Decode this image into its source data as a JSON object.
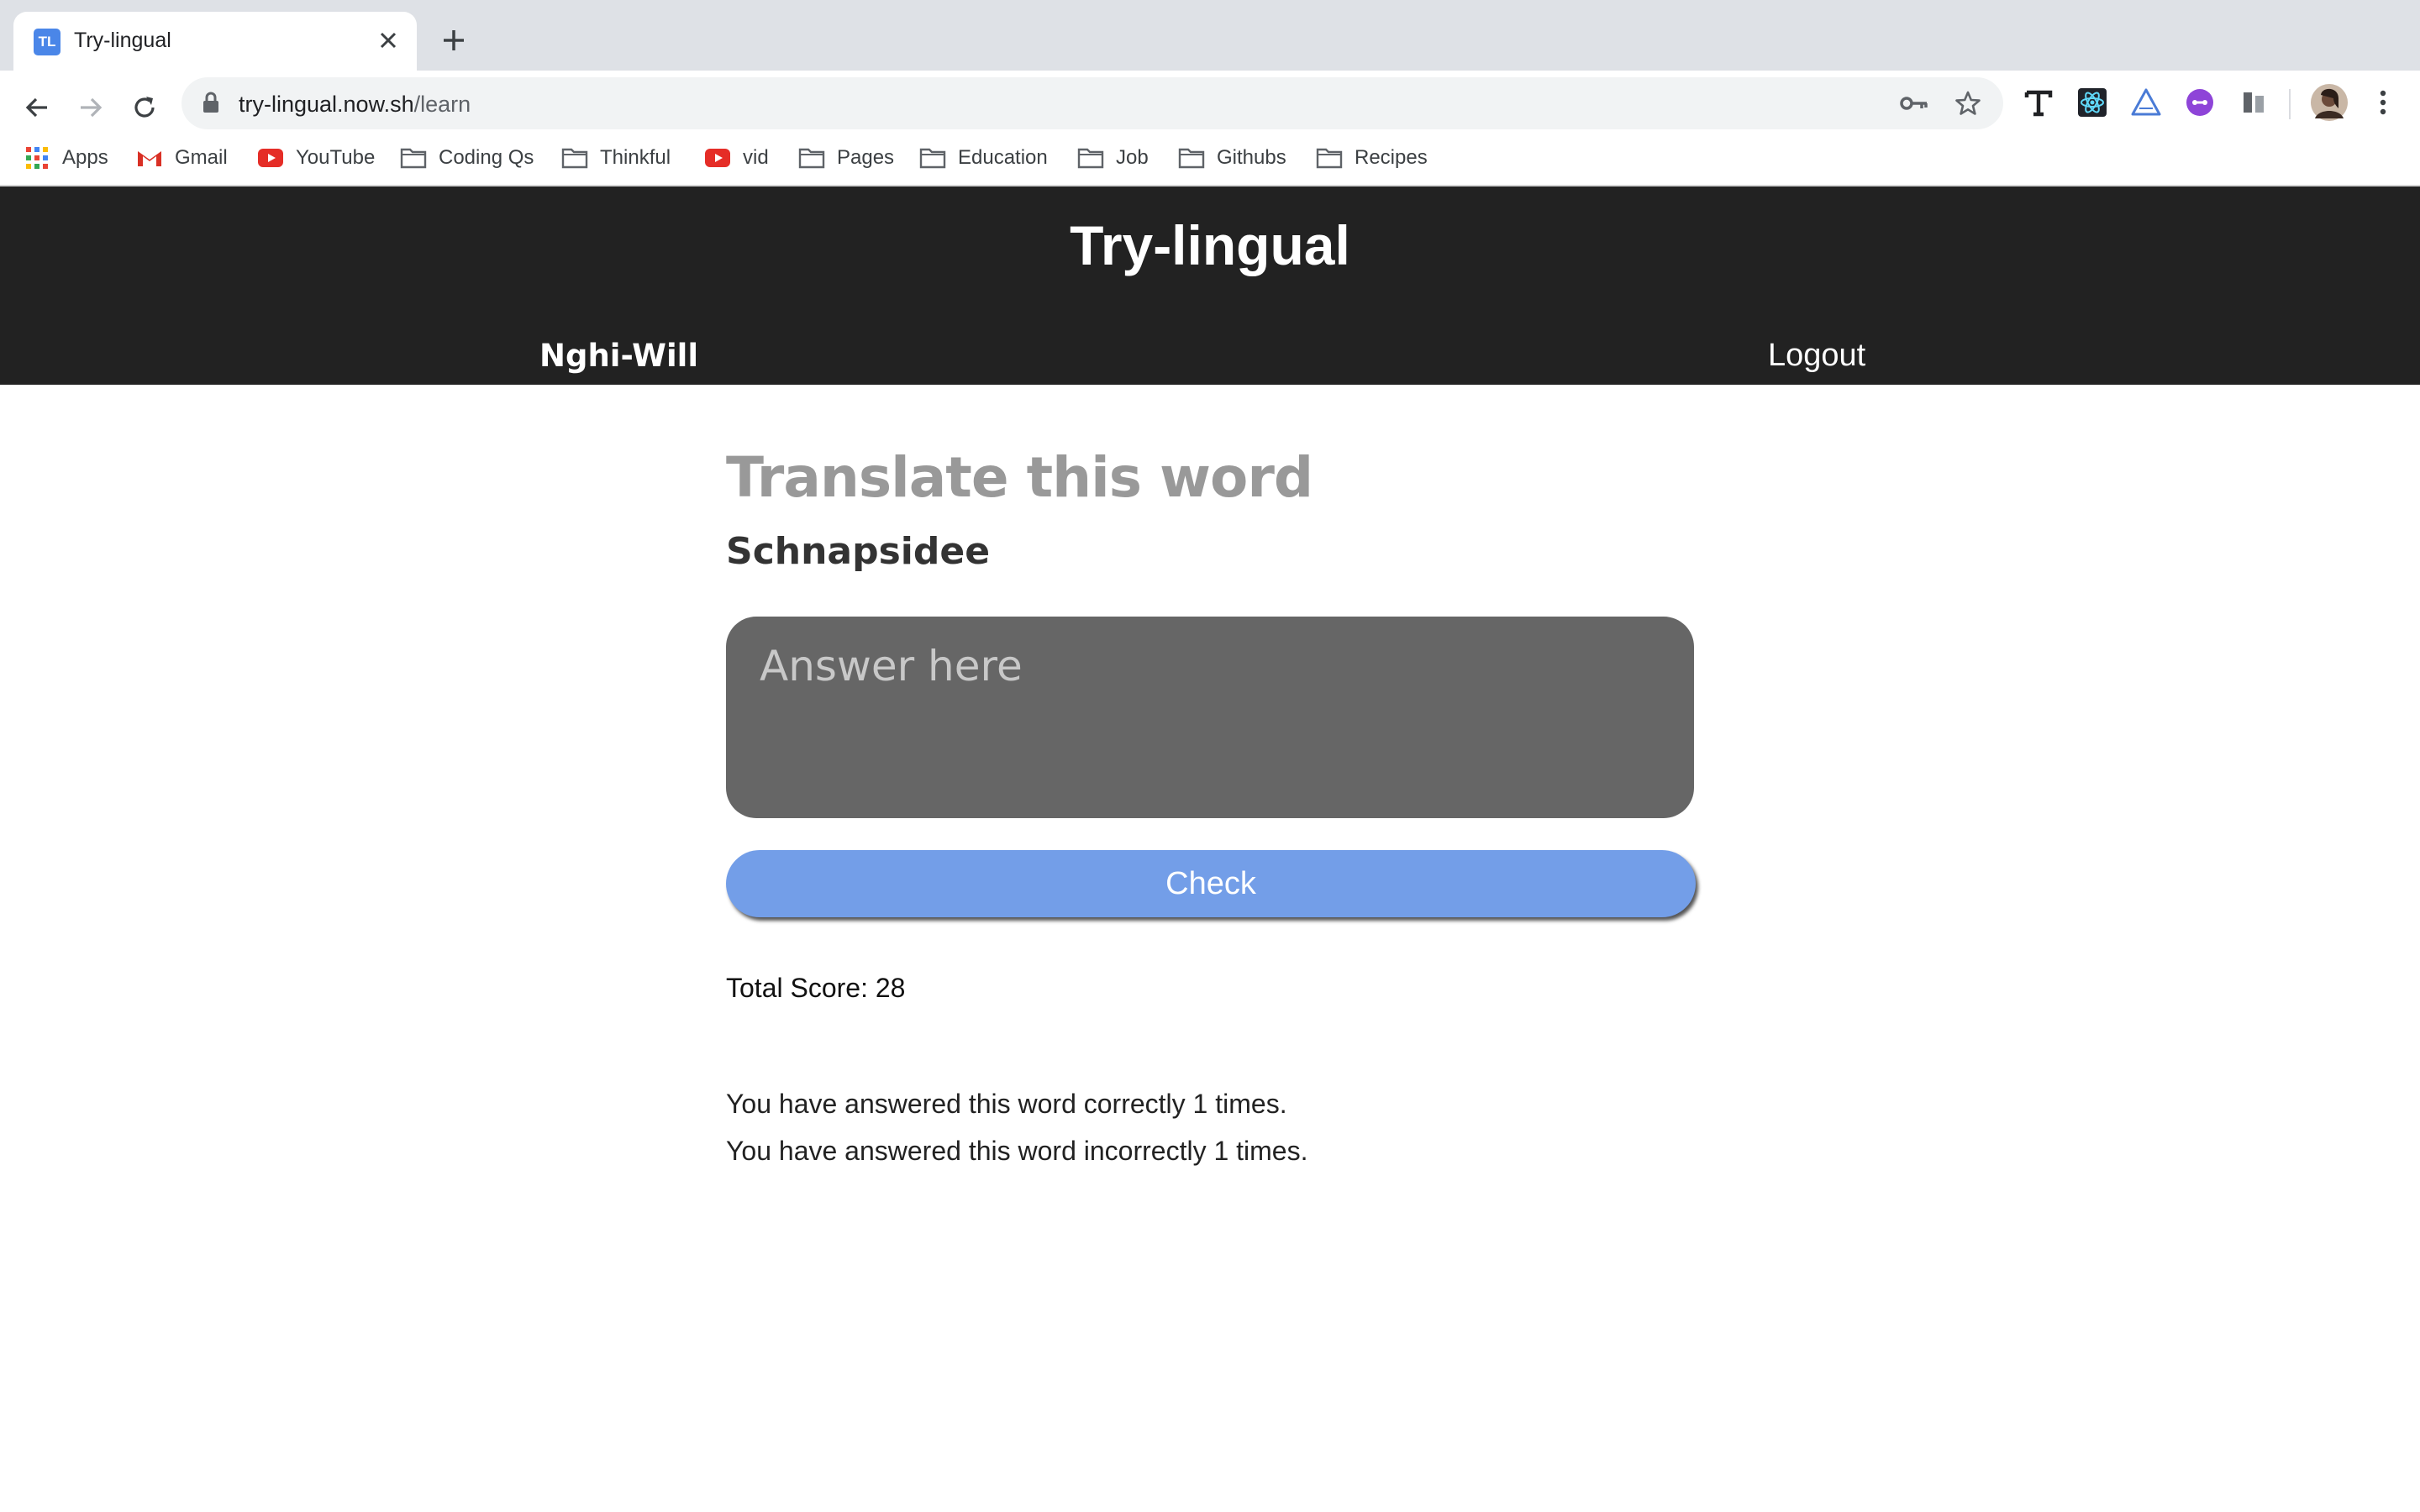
{
  "browser": {
    "tab_title": "Try-lingual",
    "tab_favicon_text": "TL",
    "url_host": "try-lingual.now.sh",
    "url_path": "/learn",
    "bookmarks": [
      {
        "label": "Apps",
        "icon": "apps-grid-icon"
      },
      {
        "label": "Gmail",
        "icon": "gmail-icon"
      },
      {
        "label": "YouTube",
        "icon": "youtube-icon"
      },
      {
        "label": "Coding Qs",
        "icon": "folder-icon"
      },
      {
        "label": "Thinkful",
        "icon": "folder-icon"
      },
      {
        "label": "vid",
        "icon": "youtube-icon"
      },
      {
        "label": "Pages",
        "icon": "folder-icon"
      },
      {
        "label": "Education",
        "icon": "folder-icon"
      },
      {
        "label": "Job",
        "icon": "folder-icon"
      },
      {
        "label": "Githubs",
        "icon": "folder-icon"
      },
      {
        "label": "Recipes",
        "icon": "folder-icon"
      }
    ]
  },
  "header": {
    "title": "Try-lingual",
    "user": "Nghi-Will",
    "logout": "Logout"
  },
  "learn": {
    "heading": "Translate this word",
    "word": "Schnapsidee",
    "answer_placeholder": "Answer here",
    "check_label": "Check",
    "total_score": "Total Score: 28",
    "correct_text": "You have answered this word correctly 1 times.",
    "incorrect_text": "You have answered this word incorrectly 1 times."
  },
  "colors": {
    "header_bg": "#222222",
    "answer_bg": "#666666",
    "check_bg": "#739ee8",
    "heading": "#999999"
  }
}
